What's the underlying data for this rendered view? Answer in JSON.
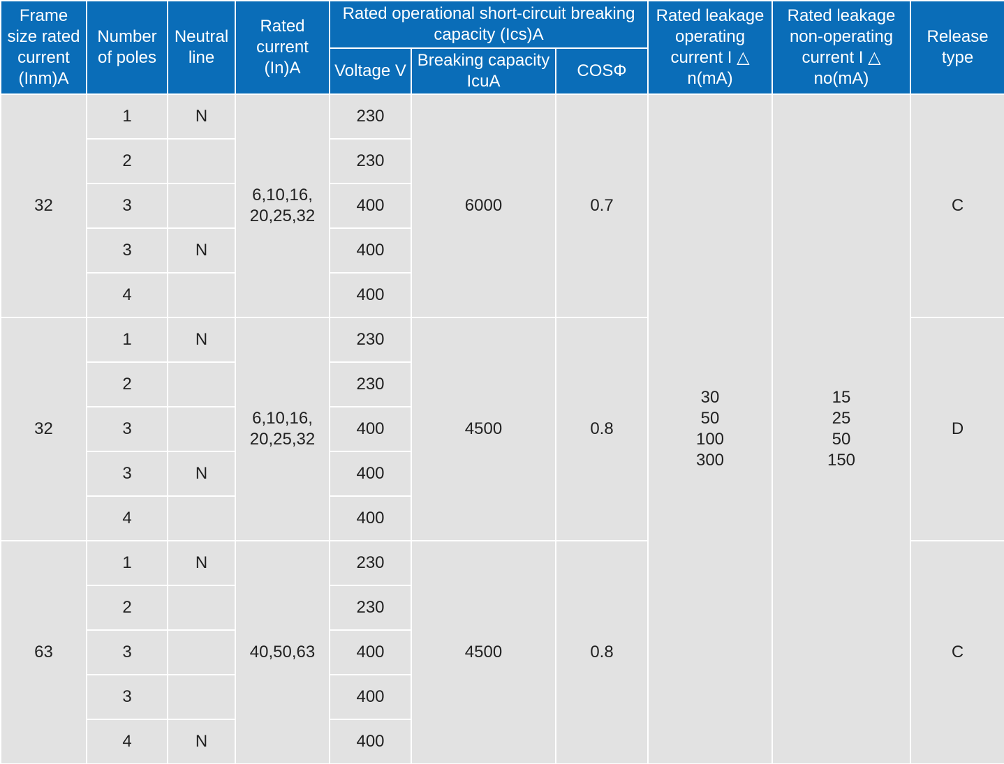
{
  "columns": {
    "frame_size": "Frame size rated current (Inm)A",
    "poles": "Number of poles",
    "neutral": "Neutral line",
    "rated_current": "Rated current (In)A",
    "ics_group": "Rated operational short-circuit breaking capacity (Ics)A",
    "voltage": "Voltage V",
    "breaking_capacity": "Breaking capacity IcuA",
    "cos": "COSΦ",
    "leak_operating": "Rated leakage operating current I △ n(mA)",
    "leak_nonoperating": "Rated leakage non-operating current I △ no(mA)",
    "release_type": "Release type"
  },
  "leakage_operating": "30\n50\n100\n300",
  "leakage_nonoperating": "15\n25\n50\n150",
  "groups": [
    {
      "frame": "32",
      "rated_current": "6,10,16,\n20,25,32",
      "breaking": "6000",
      "cos": "0.7",
      "release": "C",
      "rows": [
        {
          "poles": "1",
          "neutral": "N",
          "voltage": "230"
        },
        {
          "poles": "2",
          "neutral": "",
          "voltage": "230"
        },
        {
          "poles": "3",
          "neutral": "",
          "voltage": "400"
        },
        {
          "poles": "3",
          "neutral": "N",
          "voltage": "400"
        },
        {
          "poles": "4",
          "neutral": "",
          "voltage": "400"
        }
      ]
    },
    {
      "frame": "32",
      "rated_current": "6,10,16,\n20,25,32",
      "breaking": "4500",
      "cos": "0.8",
      "release": "D",
      "rows": [
        {
          "poles": "1",
          "neutral": "N",
          "voltage": "230"
        },
        {
          "poles": "2",
          "neutral": "",
          "voltage": "230"
        },
        {
          "poles": "3",
          "neutral": "",
          "voltage": "400"
        },
        {
          "poles": "3",
          "neutral": "N",
          "voltage": "400"
        },
        {
          "poles": "4",
          "neutral": "",
          "voltage": "400"
        }
      ]
    },
    {
      "frame": "63",
      "rated_current": "40,50,63",
      "breaking": "4500",
      "cos": "0.8",
      "release": "C",
      "rows": [
        {
          "poles": "1",
          "neutral": "N",
          "voltage": "230"
        },
        {
          "poles": "2",
          "neutral": "",
          "voltage": "230"
        },
        {
          "poles": "3",
          "neutral": "",
          "voltage": "400"
        },
        {
          "poles": "3",
          "neutral": "",
          "voltage": "400"
        },
        {
          "poles": "4",
          "neutral": "N",
          "voltage": "400"
        }
      ]
    }
  ]
}
